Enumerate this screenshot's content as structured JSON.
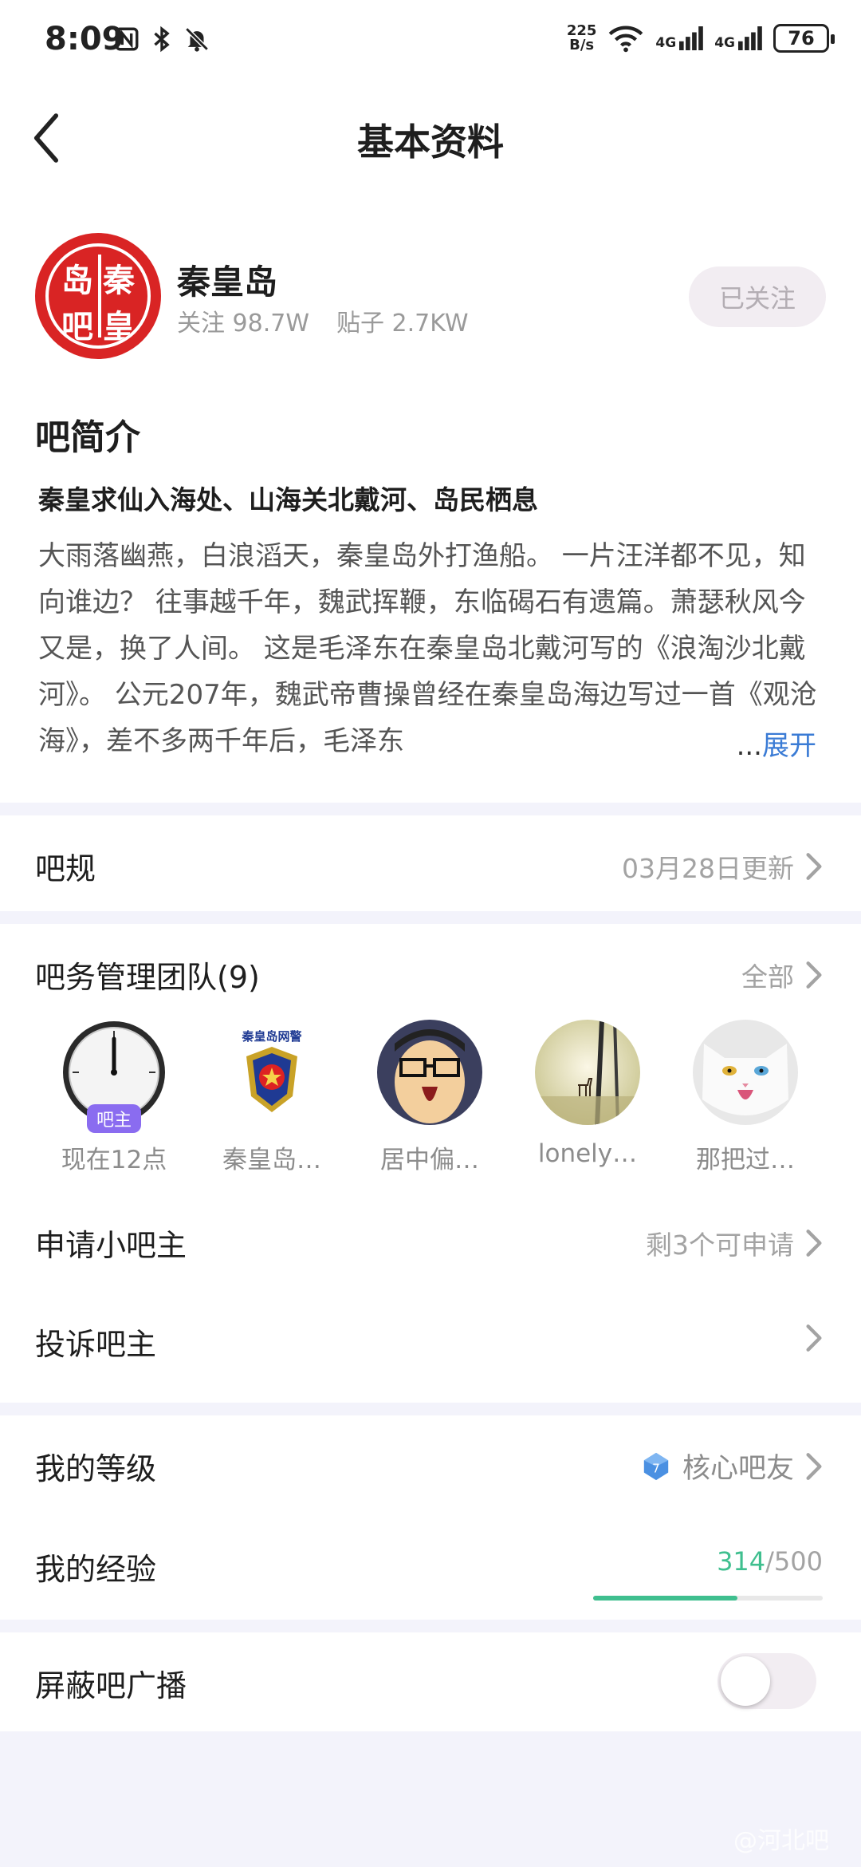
{
  "status_bar": {
    "time": "8:09",
    "speed_value": "225",
    "speed_unit": "B/s",
    "net1": "4G",
    "net2": "4G",
    "battery": "76"
  },
  "nav": {
    "title": "基本资料",
    "back_icon": "chevron-left-icon"
  },
  "forum": {
    "logo_chars": [
      "岛",
      "秦",
      "吧",
      "皇"
    ],
    "name": "秦皇岛",
    "followers": "关注 98.7W",
    "posts": "贴子 2.7KW",
    "follow_button": "已关注"
  },
  "intro": {
    "title": "吧简介",
    "subtitle": "秦皇求仙入海处、山海关北戴河、岛民栖息",
    "body": "大雨落幽燕，白浪滔天，秦皇岛外打渔船。 一片汪洋都不见，知向谁边？ 往事越千年，魏武挥鞭，东临碣石有遗篇。萧瑟秋风今又是，换了人间。 这是毛泽东在秦皇岛北戴河写的《浪淘沙北戴河》。 公元207年，魏武帝曹操曾经在秦皇岛海边写过一首《观沧海》，差不多两千年后，毛泽东",
    "ellipsis": "...",
    "expand": "展开"
  },
  "rules": {
    "label": "吧规",
    "updated": "03月28日更新"
  },
  "team": {
    "title": "吧务管理团队(9)",
    "all_label": "全部",
    "owner_badge": "吧主",
    "members": [
      {
        "name": "现在12点",
        "avatar": "clock-avatar"
      },
      {
        "name": "秦皇岛…",
        "avatar": "police-emblem-avatar",
        "caption": "秦皇岛网警"
      },
      {
        "name": "居中偏…",
        "avatar": "cartoon-face-avatar"
      },
      {
        "name": "lonely…",
        "avatar": "deer-landscape-avatar"
      },
      {
        "name": "那把过…",
        "avatar": "white-cat-avatar"
      }
    ]
  },
  "apply": {
    "label": "申请小吧主",
    "status": "剩3个可申请"
  },
  "complain": {
    "label": "投诉吧主"
  },
  "level": {
    "label": "我的等级",
    "level_number": "7",
    "title": "核心吧友"
  },
  "experience": {
    "label": "我的经验",
    "current": "314",
    "separator": "/",
    "max": "500",
    "progress": 0.628
  },
  "block_broadcast": {
    "label": "屏蔽吧广播",
    "enabled": false
  },
  "watermark": "@河北吧",
  "colors": {
    "accent_green": "#3fbf8f",
    "link_blue": "#3a7bd5",
    "owner_badge": "#8a6cf0",
    "logo_red": "#d92424"
  }
}
